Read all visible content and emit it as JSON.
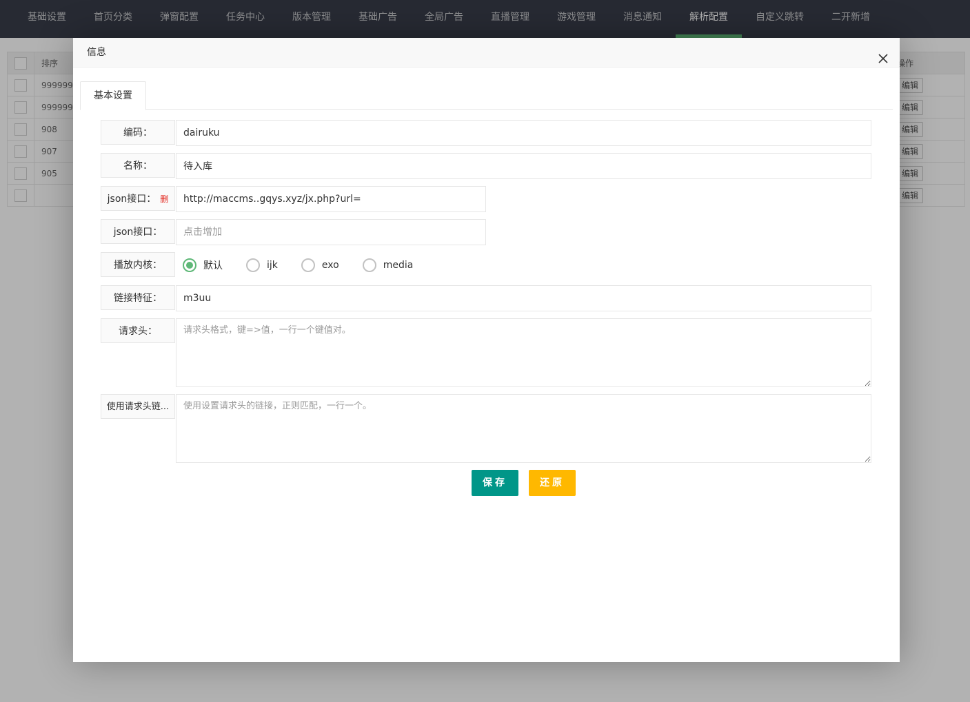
{
  "topnav": {
    "items": [
      "基础设置",
      "首页分类",
      "弹窗配置",
      "任务中心",
      "版本管理",
      "基础广告",
      "全局广告",
      "直播管理",
      "游戏管理",
      "消息通知",
      "解析配置",
      "自定义跳转",
      "二开新增"
    ],
    "active_index": 10
  },
  "table": {
    "header_sort": "排序",
    "header_action": "操作",
    "rows": [
      "999999",
      "999999",
      "908",
      "907",
      "905",
      ""
    ],
    "edit_label": "编辑"
  },
  "modal": {
    "title": "信息",
    "tab": "基本设置",
    "fields": {
      "code": {
        "label": "编码：",
        "value": "dairuku"
      },
      "name": {
        "label": "名称：",
        "value": "待入库"
      },
      "json1": {
        "label": "json接口：",
        "del": "删",
        "value": "http://maccms..gqys.xyz/jx.php?url="
      },
      "json2": {
        "label": "json接口：",
        "placeholder": "点击增加"
      },
      "kernel": {
        "label": "播放内核：",
        "options": [
          "默认",
          "ijk",
          "exo",
          "media"
        ],
        "selected": "默认"
      },
      "feature": {
        "label": "链接特征：",
        "value": "m3uu"
      },
      "headers": {
        "label": "请求头：",
        "placeholder": "请求头格式，键=>值，一行一个键值对。"
      },
      "header_links": {
        "label": "使用请求头链...",
        "placeholder": "使用设置请求头的链接，正则匹配，一行一个。"
      }
    },
    "save_label": "保存",
    "reset_label": "还原"
  },
  "colors": {
    "nav_bg": "#393d49",
    "nav_active": "#5fb878",
    "save": "#009688",
    "reset": "#ffb800",
    "radio_checked": "#5fb878"
  }
}
